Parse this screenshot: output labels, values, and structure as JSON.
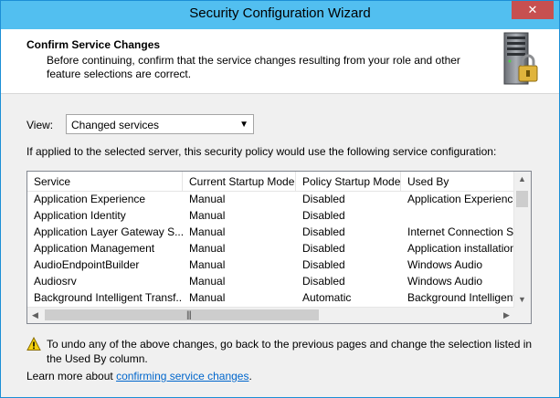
{
  "window": {
    "title": "Security Configuration Wizard",
    "close_glyph": "✕"
  },
  "header": {
    "title": "Confirm Service Changes",
    "description": "Before continuing, confirm that the service changes resulting from your role and other feature selections are correct.",
    "icon": "server-lock-icon"
  },
  "view": {
    "label": "View:",
    "selected": "Changed services"
  },
  "info_line": "If applied to the selected server, this security policy would use the following service configuration:",
  "table": {
    "columns": [
      "Service",
      "Current Startup Mode",
      "Policy Startup Mode",
      "Used By"
    ],
    "rows": [
      [
        "Application Experience",
        "Manual",
        "Disabled",
        "Application Experience"
      ],
      [
        "Application Identity",
        "Manual",
        "Disabled",
        ""
      ],
      [
        "Application Layer Gateway S...",
        "Manual",
        "Disabled",
        "Internet Connection Sh"
      ],
      [
        "Application Management",
        "Manual",
        "Disabled",
        "Application installation"
      ],
      [
        "AudioEndpointBuilder",
        "Manual",
        "Disabled",
        "Windows Audio"
      ],
      [
        "Audiosrv",
        "Manual",
        "Disabled",
        "Windows Audio"
      ],
      [
        "Background Intelligent Transf...",
        "Manual",
        "Automatic",
        "Background Intelligent"
      ]
    ]
  },
  "warning": {
    "text": "To undo any of the above changes, go back to the previous pages and change the selection listed in the Used By column."
  },
  "learn_more": {
    "prefix": "Learn more about ",
    "link": "confirming service changes",
    "suffix": "."
  }
}
